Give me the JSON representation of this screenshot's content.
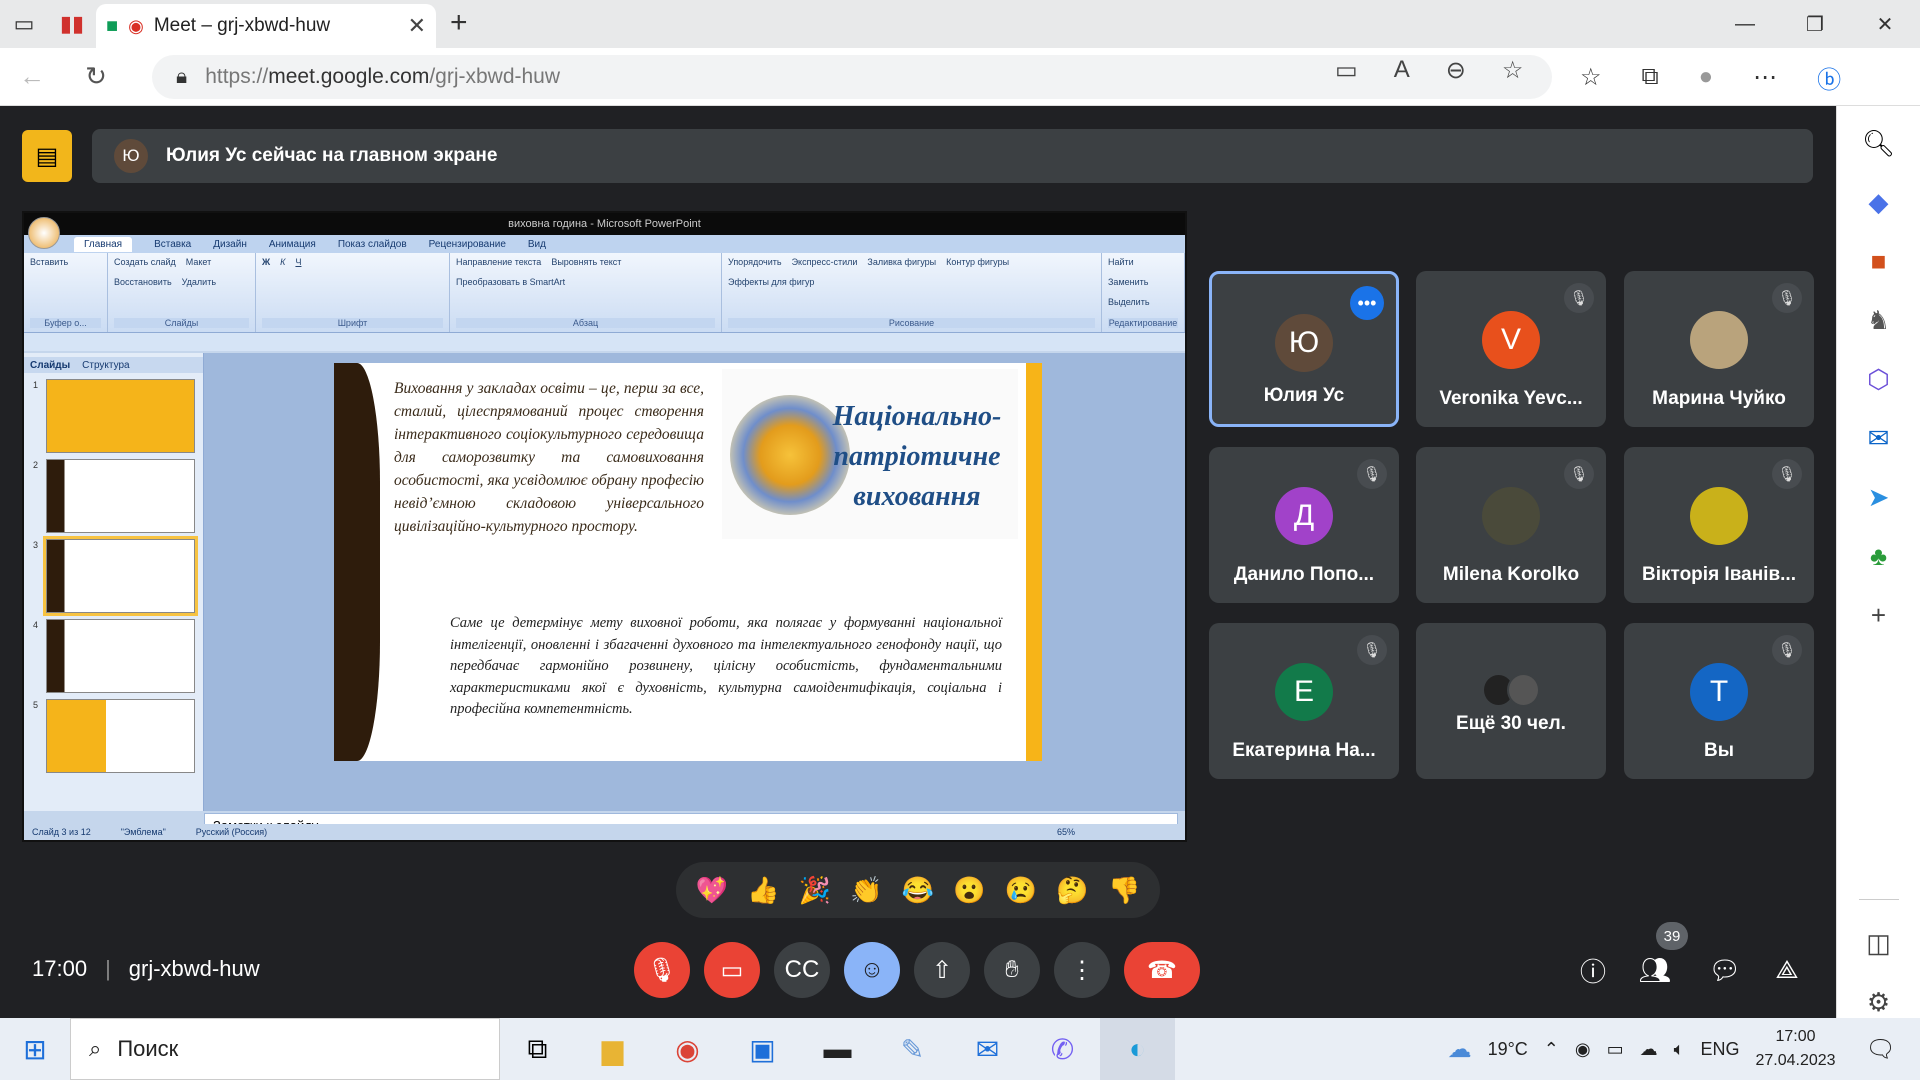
{
  "browser": {
    "tab_title": "Meet – grj-xbwd-huw",
    "url_prefix": "https://",
    "url_host": "meet.google.com",
    "url_path": "/grj-xbwd-huw"
  },
  "banner": {
    "avatar_letter": "Ю",
    "text": "Юлия Ус сейчас на главном экране"
  },
  "powerpoint": {
    "title": "виховна година - Microsoft PowerPoint",
    "tabs": [
      "Главная",
      "Вставка",
      "Дизайн",
      "Анимация",
      "Показ слайдов",
      "Рецензирование",
      "Вид"
    ],
    "groups": [
      "Буфер о...",
      "Слайды",
      "Шрифт",
      "Абзац",
      "Рисование",
      "Редактирование"
    ],
    "buttons": {
      "paste": "Вставить",
      "new_slide": "Создать слайд",
      "layout": "Макет",
      "reset": "Восстановить",
      "delete": "Удалить",
      "arrange": "Упорядочить",
      "styles": "Экспресс-стили",
      "find": "Найти",
      "replace": "Заменить",
      "select": "Выделить",
      "text_dir": "Направление текста",
      "align_text": "Выровнять текст",
      "smartart": "Преобразовать в SmartArt",
      "fill": "Заливка фигуры",
      "outline": "Контур фигуры",
      "effects": "Эффекты для фигур"
    },
    "panel_tabs": [
      "Слайды",
      "Структура"
    ],
    "slide_heading": "Національно-патріотичне виховання",
    "para1": "Виховання у закладах освіти – це, перш за все, сталий, цілеспрямований процес створення інтерактивного соціокультурного середовища для саморозвитку та самовиховання особистості, яка усвідомлює обрану професію невід’ємною складовою універсального цивілізаційно-культурного простору.",
    "para2": "Саме це детермінує мету виховної роботи, яка полягає у формуванні національної інтелігенції, оновленні і збагаченні духовного та інтелектуального генофонду нації, що передбачає гармонійно розвинену, цілісну особистість, фундаментальними характеристиками якої є духовність, культурна самоідентифікація, соціальна і професійна компетентність.",
    "notes": "Заметки к слайду",
    "status": [
      "Слайд 3 из 12",
      "\"Эмблема\"",
      "Русский (Россия)"
    ],
    "zoom": "65%",
    "thumb_numbers": [
      "1",
      "2",
      "3",
      "4",
      "5"
    ]
  },
  "participants": [
    {
      "name": "Юлия Ус",
      "letter": "Ю",
      "color": "#5f4a3a",
      "active": true
    },
    {
      "name": "Veronika Yevc...",
      "letter": "V",
      "color": "#e8501c"
    },
    {
      "name": "Марина Чуйко",
      "letter": "",
      "color": "#b9a37c"
    },
    {
      "name": "Данило Попо...",
      "letter": "Д",
      "color": "#a142c9"
    },
    {
      "name": "Milena Korolko",
      "letter": "",
      "color": "#4a4a3a"
    },
    {
      "name": "Вікторія Іванів...",
      "letter": "",
      "color": "#c9b11a"
    },
    {
      "name": "Екатерина На...",
      "letter": "Е",
      "color": "#127a4a"
    },
    {
      "name": "Ещё 30 чел.",
      "letter": "",
      "color": "#555"
    },
    {
      "name": "Вы",
      "letter": "T",
      "color": "#1466c4"
    }
  ],
  "reactions": [
    "💖",
    "👍",
    "🎉",
    "👏",
    "😂",
    "😮",
    "😢",
    "🤔",
    "👎"
  ],
  "meeting": {
    "time": "17:00",
    "code": "grj-xbwd-huw",
    "participant_count": "39"
  },
  "taskbar": {
    "search": "Поиск",
    "weather": "19°C",
    "lang": "ENG",
    "time": "17:00",
    "date": "27.04.2023"
  }
}
